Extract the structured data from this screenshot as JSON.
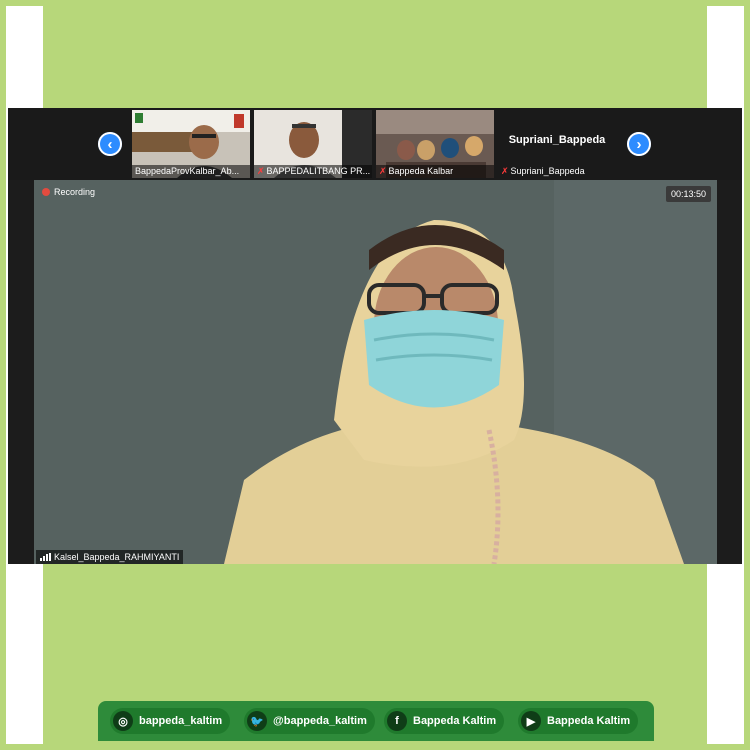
{
  "colors": {
    "outer_green": "#b7d77a",
    "zoom_bg": "#1a1a1a",
    "accent_blue": "#2d8cff",
    "recording_red": "#e34b3f",
    "social_green": "#2e8b3a"
  },
  "meeting": {
    "thumbnails": [
      {
        "label": "BappedaProvKalbar_Ab...",
        "muted": false
      },
      {
        "label": "BAPPEDALITBANG PR...",
        "muted": true
      },
      {
        "label": "Bappeda Kalbar",
        "muted": true
      },
      {
        "label": "Supriani_Bappeda",
        "muted": true,
        "display_name": "Supriani_Bappeda"
      }
    ],
    "nav": {
      "prev_icon": "chevron-left-icon",
      "next_icon": "chevron-right-icon"
    },
    "recording_label": "Recording",
    "timer": "00:13:50",
    "speaker_name": "Kalsel_Bappeda_RAHMIYANTI"
  },
  "social": [
    {
      "icon": "instagram-icon",
      "label": "bappeda_kaltim"
    },
    {
      "icon": "twitter-icon",
      "label": "@bappeda_kaltim"
    },
    {
      "icon": "facebook-icon",
      "label": "Bappeda Kaltim"
    },
    {
      "icon": "youtube-icon",
      "label": "Bappeda Kaltim"
    }
  ]
}
